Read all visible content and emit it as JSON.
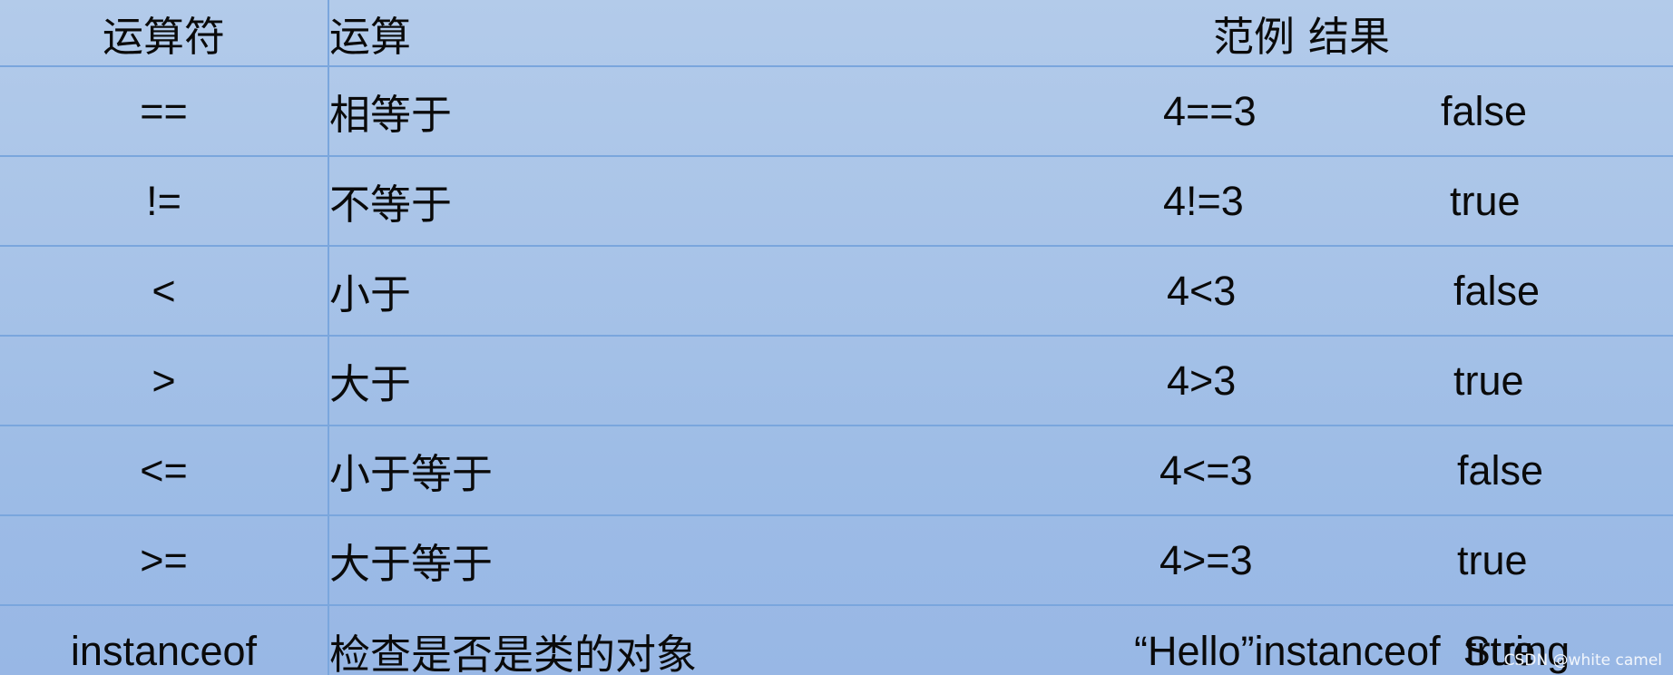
{
  "table": {
    "headers": [
      "运算符",
      "运算",
      "范例",
      "结果"
    ],
    "rows": [
      {
        "op": "==",
        "name": "相等于",
        "example": "4==3",
        "result": "false"
      },
      {
        "op": "!=",
        "name": "不等于",
        "example": "4!=3",
        "result": "true"
      },
      {
        "op": "<",
        "name": "小于",
        "example": "4<3",
        "result": "false"
      },
      {
        "op": ">",
        "name": "大于",
        "example": "4>3",
        "result": "true"
      },
      {
        "op": "<=",
        "name": "小于等于",
        "example": "4<=3",
        "result": "false"
      },
      {
        "op": ">=",
        "name": "大于等于",
        "example": "4>=3",
        "result": "true"
      },
      {
        "op": "instanceof",
        "name": "检查是否是类的对象",
        "example": "“Hello”instanceof  String",
        "result": "true"
      }
    ]
  },
  "watermark": "CSDN @white camel",
  "colors": {
    "background": "#a9c4e8",
    "grid_line": "#7aa6dd",
    "text": "#0a0a0a"
  }
}
